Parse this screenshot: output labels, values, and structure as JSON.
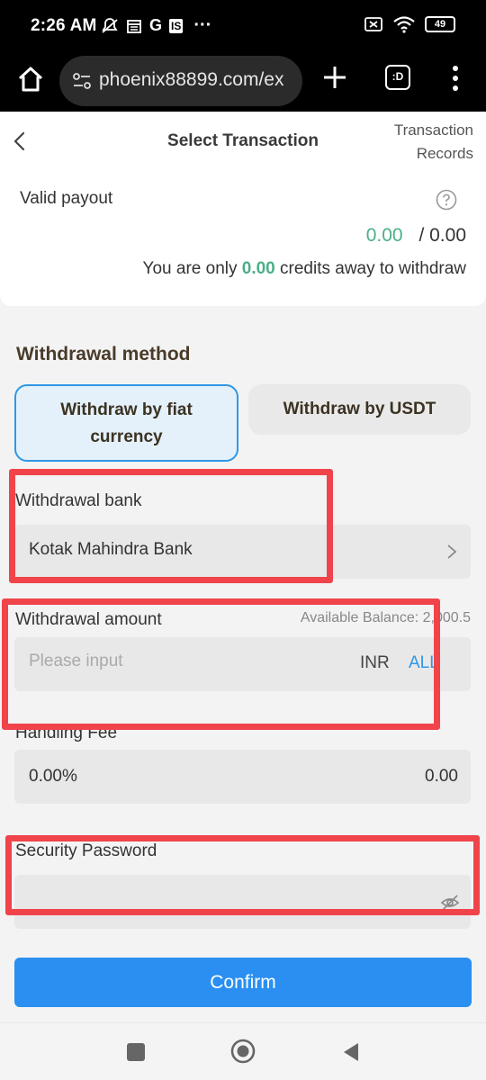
{
  "status_bar": {
    "time": "2:26 AM",
    "battery": "49",
    "g_letter": "G",
    "is_badge": "IS",
    "more_dots": "···"
  },
  "browser": {
    "url": "phoenix88899.com/ex",
    "tabs_label": ":D"
  },
  "header": {
    "title": "Select Transaction",
    "records_line1": "Transaction",
    "records_line2": "Records"
  },
  "payout": {
    "label": "Valid payout",
    "current": "0.00",
    "separator": "/",
    "total": "0.00",
    "credits_prefix": "You are only",
    "credits_value": "0.00",
    "credits_suffix": "credits away to withdraw"
  },
  "withdrawal": {
    "section_title": "Withdrawal method",
    "method_fiat_line1": "Withdraw by fiat",
    "method_fiat_line2": "currency",
    "method_usdt": "Withdraw by USDT",
    "bank_label": "Withdrawal bank",
    "bank_value": "Kotak Mahindra Bank",
    "amount_label": "Withdrawal amount",
    "available_balance": "Available Balance: 2,000.5",
    "amount_placeholder": "Please input",
    "currency": "INR",
    "all_label": "ALL",
    "fee_label": "Handling Fee",
    "fee_percent": "0.00%",
    "fee_amount": "0.00",
    "password_label": "Security Password"
  },
  "confirm_label": "Confirm",
  "colors": {
    "accent": "#2a8ff1",
    "green": "#4caf87",
    "highlight_red": "#f0434a"
  }
}
